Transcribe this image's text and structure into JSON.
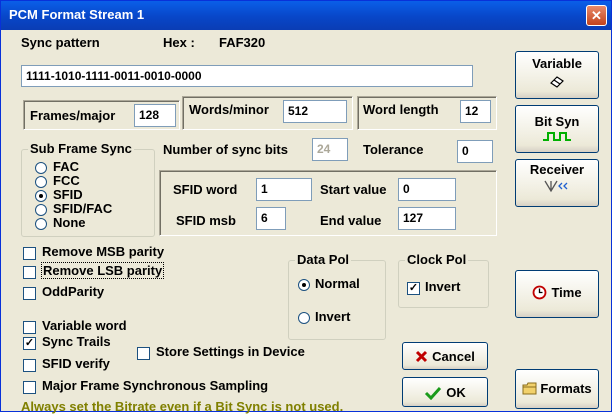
{
  "window": {
    "title": "PCM Format Stream 1",
    "close_glyph": "✕"
  },
  "sync": {
    "pattern_label": "Sync pattern",
    "hex_label": "Hex :",
    "hex_value": "FAF320",
    "pattern_value": "1111-1010-1111-0011-0010-0000"
  },
  "frames_major": {
    "label": "Frames/major",
    "value": "128"
  },
  "words_minor": {
    "label": "Words/minor",
    "value": "512"
  },
  "word_length": {
    "label": "Word length",
    "value": "12"
  },
  "subframe": {
    "legend": "Sub Frame Sync",
    "options": [
      "FAC",
      "FCC",
      "SFID",
      "SFID/FAC",
      "None"
    ],
    "selected_index": 2
  },
  "num_sync_bits": {
    "label": "Number of sync bits",
    "value": "24"
  },
  "tolerance": {
    "label": "Tolerance",
    "value": "0"
  },
  "sfid": {
    "word_label": "SFID word",
    "word_value": "1",
    "msb_label": "SFID msb",
    "msb_value": "6",
    "start_label": "Start value",
    "start_value": "0",
    "end_label": "End value",
    "end_value": "127"
  },
  "parity": {
    "remove_msb": "Remove MSB parity",
    "remove_lsb": "Remove LSB parity",
    "odd": "OddParity"
  },
  "data_pol": {
    "legend": "Data Pol",
    "normal": "Normal",
    "invert": "Invert",
    "selected": "Normal"
  },
  "clock_pol": {
    "legend": "Clock Pol",
    "invert": "Invert",
    "checked": true
  },
  "options": {
    "variable_word": "Variable word",
    "sync_trails": "Sync Trails",
    "sync_trails_checked": true,
    "sfid_verify": "SFID verify",
    "store_settings": "Store Settings in Device",
    "major_frame_sampling": "Major Frame Synchronous Sampling"
  },
  "buttons": {
    "variable": "Variable",
    "bit_syn": "Bit Syn",
    "receiver": "Receiver",
    "time": "Time",
    "cancel": "Cancel",
    "ok": "OK",
    "formats": "Formats"
  },
  "check_glyph": "✓",
  "note": "Always set the Bitrate even if a Bit Sync is not used.",
  "colors": {
    "title_bar": "#0a5fe8",
    "note_text": "#808000",
    "close_button": "#c4431c",
    "cancel_x": "#c00000",
    "ok_check": "#1a9a1a"
  }
}
